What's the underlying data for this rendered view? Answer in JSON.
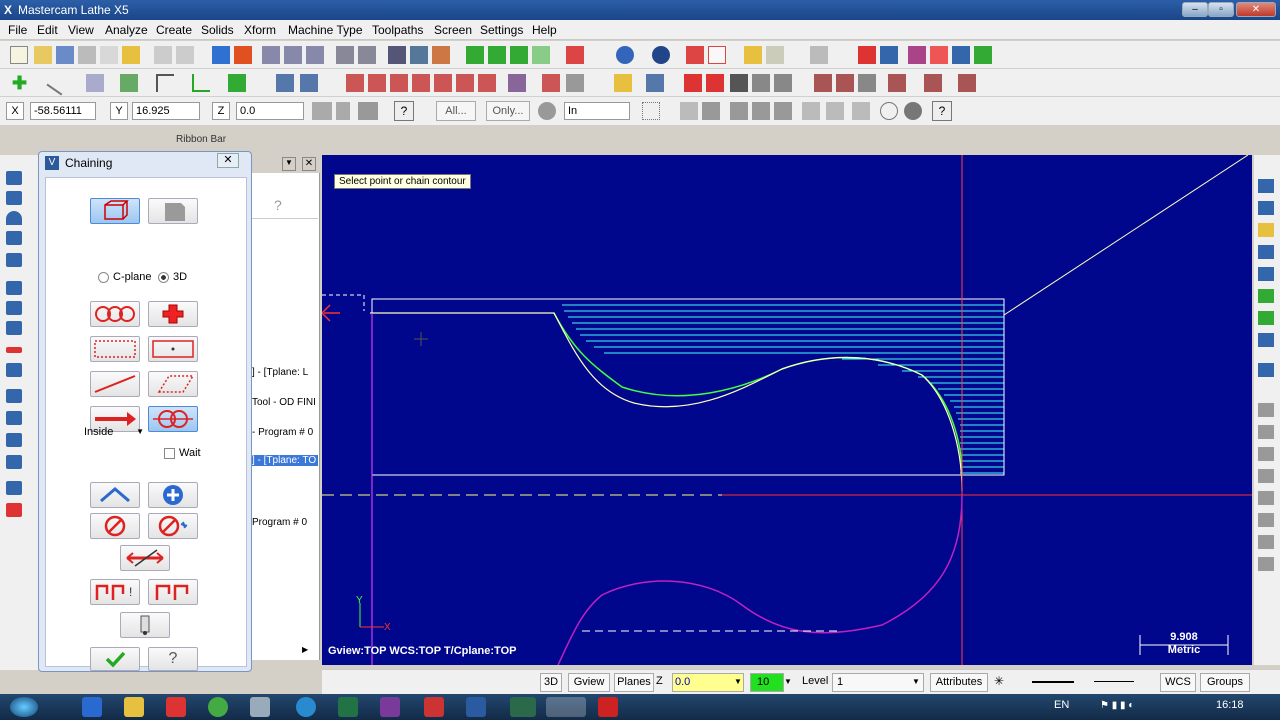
{
  "window": {
    "title": "Mastercam Lathe X5",
    "min": "–",
    "max": "▫",
    "close": "✕"
  },
  "menu": [
    "File",
    "Edit",
    "View",
    "Analyze",
    "Create",
    "Solids",
    "Xform",
    "Machine Type",
    "Toolpaths",
    "Screen",
    "Settings",
    "Help"
  ],
  "ribbon": {
    "x_label": "X",
    "x_value": "-58.56111",
    "y_label": "Y",
    "y_value": "16.925",
    "z_label": "Z",
    "z_value": "0.0",
    "all_label": "All...",
    "only_label": "Only...",
    "in_value": "In"
  },
  "ribbon_bar_label": "Ribbon Bar",
  "chaining": {
    "title": "Chaining",
    "cplane_label": "C-plane",
    "threed_label": "3D",
    "mode_select": "Inside",
    "wait_label": "Wait"
  },
  "manager_rows": [
    "] - [Tplane: L",
    "Tool - OD FINI",
    "- Program # 0",
    "] - [Tplane: TO",
    "Program # 0"
  ],
  "viewport": {
    "prompt": "Select point or chain contour",
    "status_text": "Gview:TOP   WCS:TOP   T/Cplane:TOP",
    "scale_value": "9.908",
    "scale_unit": "Metric",
    "axis_y": "Y",
    "axis_x": "X"
  },
  "statusbar": {
    "btn_3d": "3D",
    "gview": "Gview",
    "planes": "Planes",
    "z_label": "Z",
    "z_value": "0.0",
    "color_value": "10",
    "level_label": "Level",
    "level_value": "1",
    "attributes": "Attributes",
    "wcs": "WCS",
    "groups": "Groups"
  },
  "taskbar": {
    "lang": "EN",
    "time": "16:18"
  },
  "colors": {
    "viewport_bg": "#00078c",
    "geometry_yellow": "#ffff80",
    "toolpath_cyan": "#40ffff",
    "toolpath_green": "#40ff40",
    "lower_magenta": "#c020c0"
  }
}
